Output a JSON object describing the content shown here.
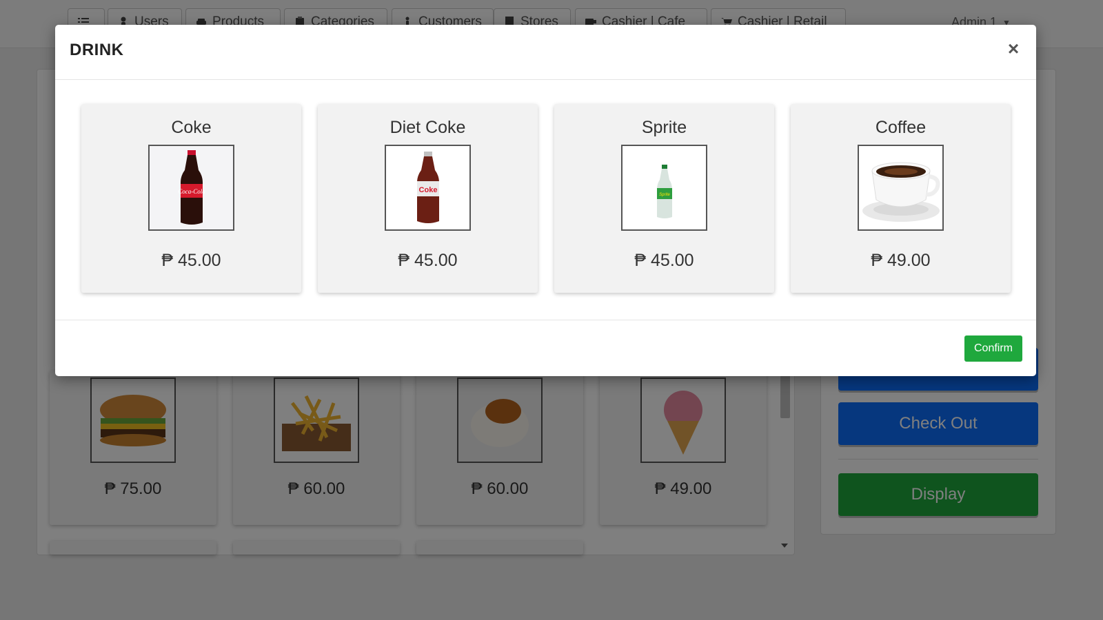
{
  "navbar": {
    "items": [
      {
        "label": "",
        "icon": "list-icon"
      },
      {
        "label": "Users",
        "icon": "user-icon"
      },
      {
        "label": "Products",
        "icon": "car-icon"
      },
      {
        "label": "Categories",
        "icon": "clipboard-icon"
      },
      {
        "label": "Customers",
        "icon": "person-icon"
      },
      {
        "label": "Stores",
        "icon": "building-icon"
      },
      {
        "label": "Cashier | Cafe",
        "icon": "coffee-icon"
      },
      {
        "label": "Cashier | Retail",
        "icon": "cart-icon"
      }
    ],
    "admin_label": "Admin 1"
  },
  "background_products": [
    {
      "price": "₱ 75.00",
      "icon": "burger-image"
    },
    {
      "price": "₱ 60.00",
      "icon": "fries-image"
    },
    {
      "price": "₱ 60.00",
      "icon": "rice-gravy-image"
    },
    {
      "price": "₱ 49.00",
      "icon": "ice-cream-image"
    }
  ],
  "side_panel": {
    "checkout_label": "Check Out",
    "display_label": "Display"
  },
  "modal": {
    "title": "DRINK",
    "close_symbol": "×",
    "confirm_label": "Confirm",
    "items": [
      {
        "name": "Coke",
        "price": "₱ 45.00",
        "icon": "coke-bottle-image"
      },
      {
        "name": "Diet Coke",
        "price": "₱ 45.00",
        "icon": "diet-coke-bottle-image"
      },
      {
        "name": "Sprite",
        "price": "₱ 45.00",
        "icon": "sprite-bottle-image"
      },
      {
        "name": "Coffee",
        "price": "₱ 49.00",
        "icon": "coffee-cup-image"
      }
    ]
  },
  "colors": {
    "confirm_green": "#1fa83d",
    "checkout_blue": "#0d6efd",
    "display_green": "#1ea83c"
  }
}
